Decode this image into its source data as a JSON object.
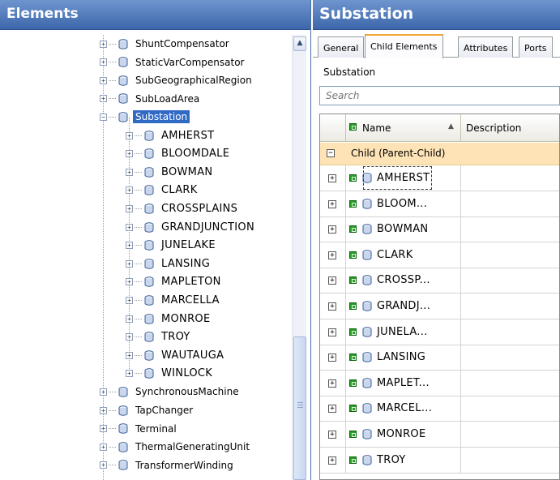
{
  "left_panel": {
    "title": "Elements",
    "tree_items": [
      {
        "label": "ShuntCompensator",
        "level": 0
      },
      {
        "label": "StaticVarCompensator",
        "level": 0
      },
      {
        "label": "SubGeographicalRegion",
        "level": 0
      },
      {
        "label": "SubLoadArea",
        "level": 0
      },
      {
        "label": "Substation",
        "level": 0,
        "expanded": true,
        "selected": true
      },
      {
        "label": "AMHERST",
        "level": 1
      },
      {
        "label": "BLOOMDALE",
        "level": 1
      },
      {
        "label": "BOWMAN",
        "level": 1
      },
      {
        "label": "CLARK",
        "level": 1
      },
      {
        "label": "CROSSPLAINS",
        "level": 1
      },
      {
        "label": "GRANDJUNCTION",
        "level": 1
      },
      {
        "label": "JUNELAKE",
        "level": 1
      },
      {
        "label": "LANSING",
        "level": 1
      },
      {
        "label": "MAPLETON",
        "level": 1
      },
      {
        "label": "MARCELLA",
        "level": 1
      },
      {
        "label": "MONROE",
        "level": 1
      },
      {
        "label": "TROY",
        "level": 1
      },
      {
        "label": "WAUTAUGA",
        "level": 1
      },
      {
        "label": "WINLOCK",
        "level": 1
      },
      {
        "label": "SynchronousMachine",
        "level": 0
      },
      {
        "label": "TapChanger",
        "level": 0
      },
      {
        "label": "Terminal",
        "level": 0
      },
      {
        "label": "ThermalGeneratingUnit",
        "level": 0
      },
      {
        "label": "TransformerWinding",
        "level": 0
      }
    ],
    "collapse_glyph": "−",
    "expand_glyph": "+",
    "scroll_up_glyph": "▲"
  },
  "right_panel": {
    "title": "Substation",
    "tabs": [
      "General",
      "Child Elements",
      "Attributes",
      "Ports"
    ],
    "active_tab": "Child Elements",
    "subtitle": "Substation",
    "search_placeholder": "Search",
    "grid": {
      "columns": {
        "name": "Name",
        "description": "Description"
      },
      "sort_glyph": "▲",
      "group_label": "Child  (Parent-Child)",
      "group_glyph": "−",
      "expand_glyph": "+",
      "rows": [
        "AMHERST",
        "BLOOM...",
        "BOWMAN",
        "CLARK",
        "CROSSP...",
        "GRANDJ...",
        "JUNELA...",
        "LANSING",
        "MAPLET...",
        "MARCEL...",
        "MONROE",
        "TROY"
      ]
    }
  },
  "colors": {
    "header_blue": "#3d67ab",
    "selection_blue": "#316ac5",
    "group_orange": "#fde3b5",
    "tab_accent": "#f1a535",
    "status_green": "#2a9d2a"
  },
  "icons": {
    "element_icon": "cylinder-icon",
    "status_icon": "green-status-icon"
  }
}
